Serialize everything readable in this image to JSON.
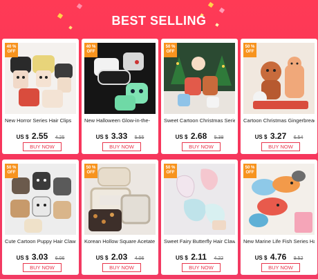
{
  "header": {
    "title": "BEST SELLING"
  },
  "products": [
    {
      "badge": "40 % OFF",
      "name": "New Horror Series Hair Clips",
      "currency": "US $",
      "price": "2.55",
      "old_price": "4.25",
      "buy_label": "BUY NOW"
    },
    {
      "badge": "40 % OFF",
      "name": "New Halloween Glow-in-the-",
      "currency": "US $",
      "price": "3.33",
      "old_price": "5.55",
      "buy_label": "BUY NOW"
    },
    {
      "badge": "50 % OFF",
      "name": "Sweet Cartoon Christmas Series",
      "currency": "US $",
      "price": "2.68",
      "old_price": "5.38",
      "buy_label": "BUY NOW"
    },
    {
      "badge": "50 % OFF",
      "name": "Cartoon Christmas Gingerbread",
      "currency": "US $",
      "price": "3.27",
      "old_price": "6.54",
      "buy_label": "BUY NOW"
    },
    {
      "badge": "50 % OFF",
      "name": "Cute Cartoon Puppy Hair Claw",
      "currency": "US $",
      "price": "3.03",
      "old_price": "6.06",
      "buy_label": "BUY NOW"
    },
    {
      "badge": "50 % OFF",
      "name": "Korean Hollow Square Acetate",
      "currency": "US $",
      "price": "2.03",
      "old_price": "4.06",
      "buy_label": "BUY NOW"
    },
    {
      "badge": "50 % OFF",
      "name": "Sweet Fairy Butterfly Hair Claw",
      "currency": "US $",
      "price": "2.11",
      "old_price": "4.22",
      "buy_label": "BUY NOW"
    },
    {
      "badge": "50 % OFF",
      "name": "New Marine Life Fish Series Hair",
      "currency": "US $",
      "price": "4.76",
      "old_price": "9.52",
      "buy_label": "BUY NOW"
    }
  ],
  "colors": {
    "accent": "#e8334a",
    "badge": "#f7931e",
    "background": "#f8355a"
  }
}
